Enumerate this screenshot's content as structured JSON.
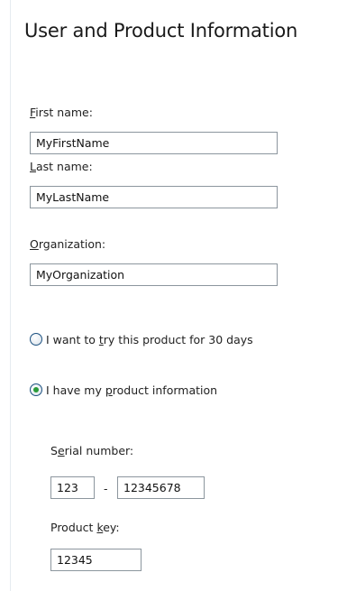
{
  "page": {
    "title": "User and Product Information"
  },
  "form": {
    "first_name": {
      "label_access": "F",
      "label_rest": "irst name:",
      "value": "MyFirstName"
    },
    "last_name": {
      "label_access": "L",
      "label_rest": "ast name:",
      "value": "MyLastName"
    },
    "organization": {
      "label_access": "O",
      "label_rest": "rganization:",
      "value": "MyOrganization"
    },
    "trial_option": {
      "label_pre": "I want to ",
      "label_access": "t",
      "label_post": "ry this product for 30 days",
      "selected": false
    },
    "product_info_option": {
      "label_pre": "I have my ",
      "label_access": "p",
      "label_post": "roduct information",
      "selected": true
    },
    "serial_number": {
      "label_pre": "S",
      "label_access": "e",
      "label_post": "rial number:",
      "part1": "123",
      "separator": "-",
      "part2": "12345678"
    },
    "product_key": {
      "label_pre": "Product ",
      "label_access": "k",
      "label_post": "ey:",
      "value": "12345"
    }
  },
  "colors": {
    "radio_selected_dot": "#2a9b3a",
    "field_border": "#8c969e"
  }
}
